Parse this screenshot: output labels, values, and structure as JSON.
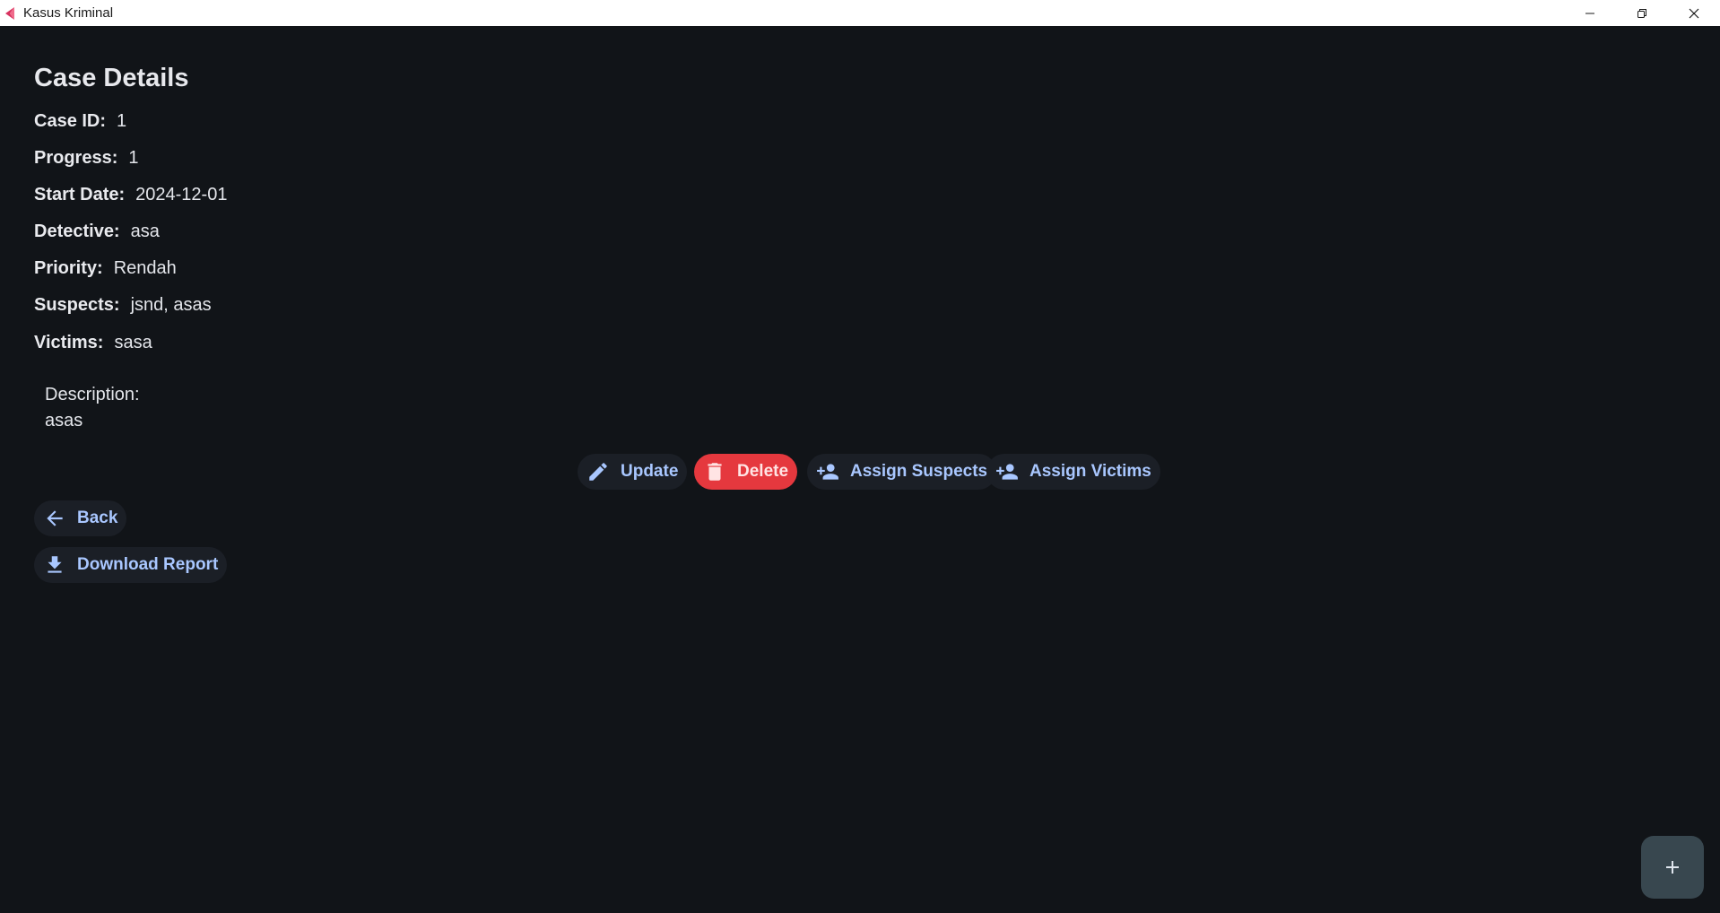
{
  "window": {
    "title": "Kasus Kriminal"
  },
  "page": {
    "title": "Case Details"
  },
  "fields": {
    "case_id": {
      "label": "Case ID:",
      "value": "1"
    },
    "progress": {
      "label": "Progress:",
      "value": "1"
    },
    "start_date": {
      "label": "Start Date:",
      "value": "2024-12-01"
    },
    "detective": {
      "label": "Detective:",
      "value": "asa"
    },
    "priority": {
      "label": "Priority:",
      "value": "Rendah"
    },
    "suspects": {
      "label": "Suspects:",
      "value": "jsnd, asas"
    },
    "victims": {
      "label": "Victims:",
      "value": "sasa"
    }
  },
  "description": {
    "label": "Description:",
    "value": "asas"
  },
  "actions": {
    "update_label": "Update",
    "delete_label": "Delete",
    "assign_suspects_label": "Assign Suspects",
    "assign_victims_label": "Assign Victims",
    "back_label": "Back",
    "download_label": "Download Report"
  },
  "icons": {
    "app": "app-logo-icon",
    "minimize": "minimize-icon",
    "restore": "restore-icon",
    "close": "close-icon",
    "update": "pencil-icon",
    "delete": "trash-icon",
    "assign_suspects": "person-add-icon",
    "assign_victims": "person-add-icon",
    "back": "arrow-left-icon",
    "download": "download-icon",
    "fab": "plus-icon"
  },
  "colors": {
    "background": "#111418",
    "accent": "#a9c7ff",
    "danger": "#e5383e",
    "fab": "#38474f"
  }
}
